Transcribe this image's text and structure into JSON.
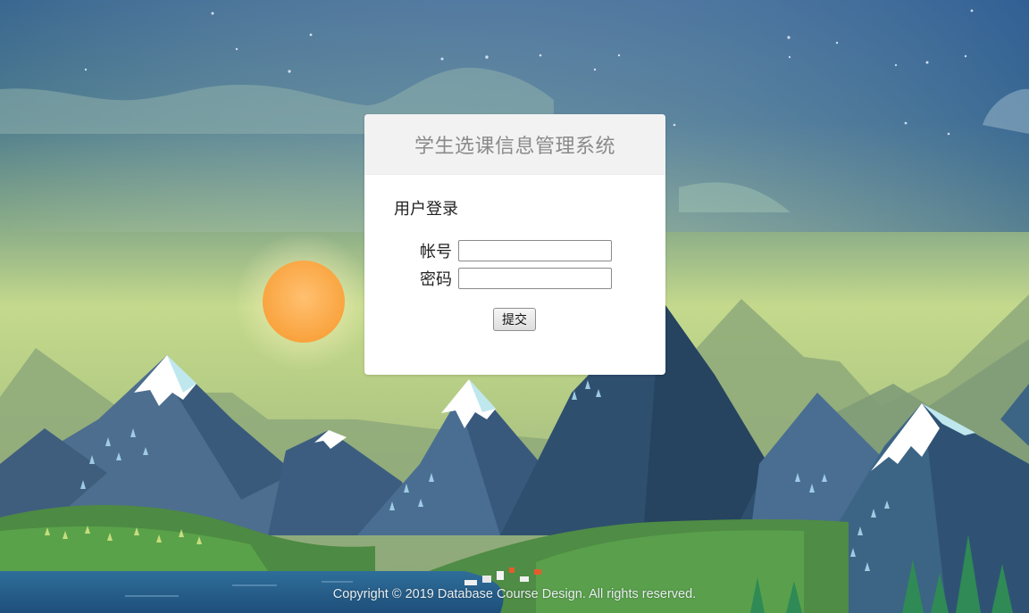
{
  "login": {
    "system_title": "学生选课信息管理系统",
    "section_title": "用户登录",
    "account_label": "帐号",
    "account_value": "",
    "password_label": "密码",
    "password_value": "",
    "submit_label": "提交"
  },
  "footer": {
    "copyright": "Copyright © 2019 Database Course Design. All rights reserved."
  }
}
